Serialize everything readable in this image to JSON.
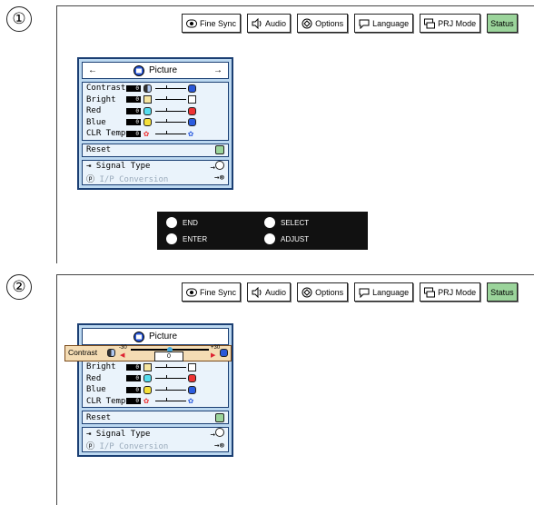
{
  "steps": [
    "①",
    "②"
  ],
  "tabs": [
    {
      "label": "Fine Sync",
      "icon": "fine-sync-icon"
    },
    {
      "label": "Audio",
      "icon": "speaker-icon"
    },
    {
      "label": "Options",
      "icon": "options-icon"
    },
    {
      "label": "Language",
      "icon": "speech-bubble-icon"
    },
    {
      "label": "PRJ Mode",
      "icon": "prj-mode-icon"
    },
    {
      "label": "Status",
      "icon": "none"
    }
  ],
  "menu": {
    "title": "Picture",
    "left_arrow": "←",
    "right_arrow": "→",
    "rows": [
      {
        "label": "Contrast",
        "value": "0",
        "left_color": "#b0c8f0",
        "right_color": "#2a58d8"
      },
      {
        "label": "Bright",
        "value": "0",
        "left_color": "#f6e6a0",
        "right_color": "#ffffff"
      },
      {
        "label": "Red",
        "value": "0",
        "left_color": "#55ddee",
        "right_color": "#ee3333"
      },
      {
        "label": "Blue",
        "value": "0",
        "left_color": "#f5e03a",
        "right_color": "#2b5cdf"
      },
      {
        "label": "CLR Temp",
        "value": "0",
        "left_color": "#ee3333",
        "right_color": "#2b5cdf"
      }
    ],
    "reset_label": "Reset",
    "signal_type_label": "Signal Type",
    "ip_conversion_label": "I/P Conversion"
  },
  "guide": {
    "end_label": "END",
    "enter_label": "ENTER",
    "select_label": "SELECT",
    "adjust_label": "ADJUST"
  },
  "adjust": {
    "label": "Contrast",
    "min": "-30",
    "max": "+30",
    "value": "0"
  }
}
